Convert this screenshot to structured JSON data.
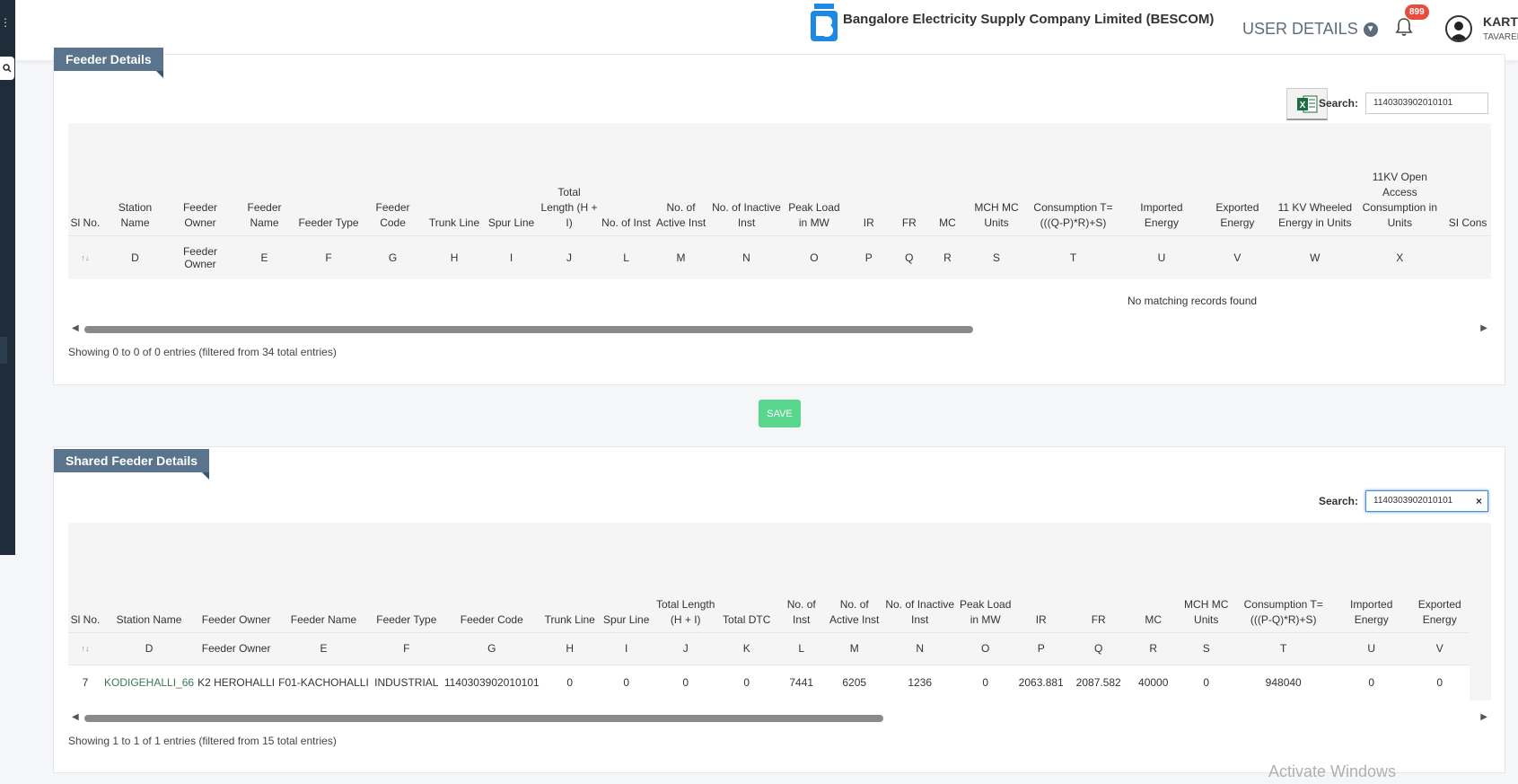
{
  "header": {
    "company": "Bangalore Electricity Supply Company Limited (BESCOM)",
    "user_details": "USER DETAILS",
    "notifications": "899",
    "user_name": "KARTHIK",
    "user_sub": "TAVAREKER"
  },
  "feeder": {
    "title": "Feeder Details",
    "search_label": "Search:",
    "search_value": "1140303902010101",
    "headers": [
      "Sl No.",
      "Station Name",
      "Feeder Owner",
      "Feeder Name",
      "Feeder Type",
      "Feeder Code",
      "Trunk Line",
      "Spur Line",
      "Total Length (H + I)",
      "No. of Inst",
      "No. of Active Inst",
      "No. of Inactive Inst",
      "Peak Load in MW",
      "IR",
      "FR",
      "MC",
      "MCH MC Units",
      "Consumption T=(((Q-P)*R)+S)",
      "Imported Energy",
      "Exported Energy",
      "11 KV Wheeled Energy in Units",
      "11KV Open Access Consumption in Units",
      "SI Cons"
    ],
    "letters": [
      "↑↓",
      "D",
      "Feeder Owner",
      "E",
      "F",
      "G",
      "H",
      "I",
      "J",
      "L",
      "M",
      "N",
      "O",
      "P",
      "Q",
      "R",
      "S",
      "T",
      "U",
      "V",
      "W",
      "X",
      ""
    ],
    "no_records": "No matching records found",
    "info": "Showing 0 to 0 of 0 entries (filtered from 34 total entries)"
  },
  "save_label": "SAVE",
  "shared": {
    "title": "Shared Feeder Details",
    "search_label": "Search:",
    "search_value": "1140303902010101",
    "clear": "×",
    "headers": [
      "Sl No.",
      "Station Name",
      "Feeder Owner",
      "Feeder Name",
      "Feeder Type",
      "Feeder Code",
      "Trunk Line",
      "Spur Line",
      "Total Length (H + I)",
      "Total DTC",
      "No. of Inst",
      "No. of Active Inst",
      "No. of Inactive Inst",
      "Peak Load in MW",
      "IR",
      "FR",
      "MC",
      "MCH MC Units",
      "Consumption T=(((P-Q)*R)+S)",
      "Imported Energy",
      "Exported Energy"
    ],
    "letters": [
      "↑↓",
      "D",
      "Feeder Owner",
      "E",
      "F",
      "G",
      "H",
      "I",
      "J",
      "K",
      "L",
      "M",
      "N",
      "O",
      "P",
      "Q",
      "R",
      "S",
      "T",
      "U",
      "V"
    ],
    "row": [
      "7",
      "KODIGEHALLI_66",
      "K2 HEROHALLI",
      "F01-KACHOHALLI",
      "INDUSTRIAL",
      "1140303902010101",
      "0",
      "0",
      "0",
      "0",
      "7441",
      "6205",
      "1236",
      "0",
      "2063.881",
      "2087.582",
      "40000",
      "0",
      "948040",
      "0",
      "0"
    ],
    "info": "Showing 1 to 1 of 1 entries (filtered from 15 total entries)"
  },
  "watermark": "Activate Windows",
  "colors": {
    "title_bg": "#59748c",
    "save": "#58d68d",
    "badge": "#e74c3c"
  }
}
